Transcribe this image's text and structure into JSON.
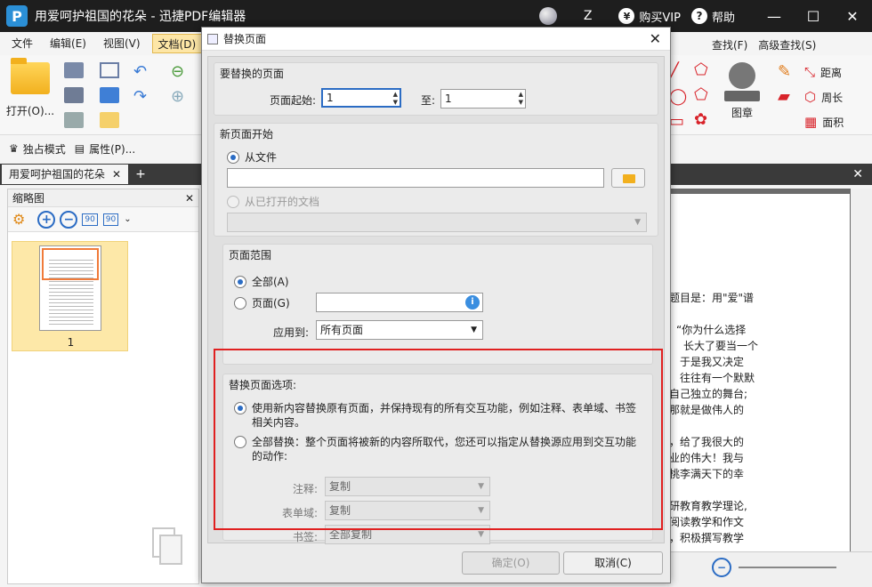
{
  "app": {
    "title": "用爱呵护祖国的花朵 - 迅捷PDF编辑器",
    "logo": "P",
    "user": "Z",
    "vip_symbol": "¥",
    "vip_label": "购买VIP",
    "help_symbol": "?",
    "help_label": "帮助"
  },
  "menu": [
    "文件",
    "编辑(E)",
    "视图(V)",
    "文档(D)"
  ],
  "toolbar": {
    "open_label": "打开(O)...",
    "stamp_label": "图章",
    "distance_label": "距离",
    "perimeter_label": "周长",
    "area_label": "面积",
    "find_label": "查找(F)",
    "advanced_find_label": "高级查找(S)",
    "solo_mode_label": "独占模式",
    "properties_label": "属性(P)..."
  },
  "doc_tab": {
    "label": "用爱呵护祖国的花朵"
  },
  "thumbnails": {
    "title": "缩略图",
    "rotate_left": "90",
    "rotate_right": "90",
    "page_number": "1"
  },
  "document_lines": [
    "题目是：用\"爱\"谱",
    "",
    "“你为什么选择",
    "长大了要当一个",
    "于是我又决定",
    "往往有一个默默",
    "自己独立的舞台;",
    "那就是做伟人的",
    "",
    "，给了我很大的",
    "业的伟大！我与",
    "桃李满天下的幸",
    "",
    "研教育教学理论,",
    "阅读教学和作文",
    "，积极撰写教学"
  ],
  "dialog": {
    "title": "替换页面",
    "close_symbol": "✕",
    "section_pages_to_replace": "要替换的页面",
    "page_start_label": "页面起始:",
    "page_start_value": "1",
    "to_label": "至:",
    "to_value": "1",
    "section_new_page_start": "新页面开始",
    "from_file_label": "从文件",
    "from_open_doc_label": "从已打开的文档",
    "section_page_range": "页面范围",
    "all_label": "全部(A)",
    "pages_label": "页面(G)",
    "info_symbol": "i",
    "apply_to_label": "应用到:",
    "apply_to_value": "所有页面",
    "section_replace_options": "替换页面选项:",
    "option_keep_interactive": "使用新内容替换原有页面，并保持现有的所有交互功能，例如注释、表单域、书签相关内容。",
    "option_full_replace": "全部替换：整个页面将被新的内容所取代，您还可以指定从替换源应用到交互功能的动作:",
    "annotations_label": "注释:",
    "annotations_value": "复制",
    "form_fields_label": "表单域:",
    "form_fields_value": "复制",
    "bookmarks_label": "书签:",
    "bookmarks_value": "全部复制",
    "ok_label": "确定(O)",
    "cancel_label": "取消(C)"
  },
  "colors": {
    "accent_blue": "#2b6cc4",
    "highlight_red": "#e02020",
    "active_menu": "#fde6a6",
    "measure_red": "#d8232a"
  }
}
